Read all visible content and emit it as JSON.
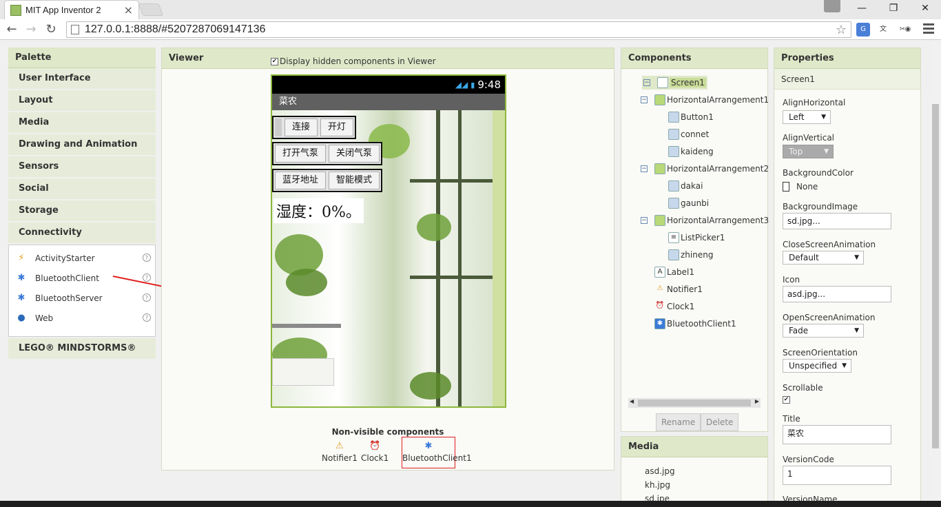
{
  "browser": {
    "tab_title": "MIT App Inventor 2",
    "url": "127.0.0.1:8888/#5207287069147136"
  },
  "palette": {
    "header": "Palette",
    "categories": [
      "User Interface",
      "Layout",
      "Media",
      "Drawing and Animation",
      "Sensors",
      "Social",
      "Storage",
      "Connectivity"
    ],
    "components": [
      {
        "label": "ActivityStarter",
        "icon": "lightning-icon"
      },
      {
        "label": "BluetoothClient",
        "icon": "bluetooth-icon"
      },
      {
        "label": "BluetoothServer",
        "icon": "bluetooth-icon"
      },
      {
        "label": "Web",
        "icon": "globe-icon"
      }
    ],
    "lego": "LEGO® MINDSTORMS®"
  },
  "viewer": {
    "header": "Viewer",
    "hidden_checkbox_label": "Display hidden components in Viewer",
    "phone": {
      "time": "9:48",
      "title": "菜农",
      "row1": [
        "连接",
        "开灯"
      ],
      "row2": [
        "打开气泵",
        "关闭气泵"
      ],
      "row3": [
        "蓝牙地址",
        "智能模式"
      ],
      "humidity": "湿度：0%。"
    },
    "nonvisible_title": "Non-visible components",
    "nonvisible": [
      {
        "label": "Notifier1",
        "icon": "warning-icon"
      },
      {
        "label": "Clock1",
        "icon": "clock-icon"
      },
      {
        "label": "BluetoothClient1",
        "icon": "bluetooth-icon"
      }
    ]
  },
  "components": {
    "header": "Components",
    "tree": [
      {
        "label": "Screen1",
        "level": 0
      },
      {
        "label": "HorizontalArrangement1",
        "level": 1
      },
      {
        "label": "Button1",
        "level": 2
      },
      {
        "label": "connet",
        "level": 2
      },
      {
        "label": "kaideng",
        "level": 2
      },
      {
        "label": "HorizontalArrangement2",
        "level": 1
      },
      {
        "label": "dakai",
        "level": 2
      },
      {
        "label": "gaunbi",
        "level": 2
      },
      {
        "label": "HorizontalArrangement3",
        "level": 1
      },
      {
        "label": "ListPicker1",
        "level": 2
      },
      {
        "label": "zhineng",
        "level": 2
      },
      {
        "label": "Label1",
        "level": 1
      },
      {
        "label": "Notifier1",
        "level": 1
      },
      {
        "label": "Clock1",
        "level": 1
      },
      {
        "label": "BluetoothClient1",
        "level": 1
      }
    ],
    "rename": "Rename",
    "delete": "Delete"
  },
  "media": {
    "header": "Media",
    "files": [
      "asd.jpg",
      "kh.jpg",
      "sd.jpe"
    ]
  },
  "properties": {
    "header": "Properties",
    "component": "Screen1",
    "align_horizontal": {
      "label": "AlignHorizontal",
      "value": "Left"
    },
    "align_vertical": {
      "label": "AlignVertical",
      "value": "Top"
    },
    "background_color": {
      "label": "BackgroundColor",
      "value": "None"
    },
    "background_image": {
      "label": "BackgroundImage",
      "value": "sd.jpg..."
    },
    "close_anim": {
      "label": "CloseScreenAnimation",
      "value": "Default"
    },
    "icon": {
      "label": "Icon",
      "value": "asd.jpg..."
    },
    "open_anim": {
      "label": "OpenScreenAnimation",
      "value": "Fade"
    },
    "orientation": {
      "label": "ScreenOrientation",
      "value": "Unspecified"
    },
    "scrollable": {
      "label": "Scrollable",
      "checked": true
    },
    "title": {
      "label": "Title",
      "value": "菜农"
    },
    "version_code": {
      "label": "VersionCode",
      "value": "1"
    },
    "version_name": {
      "label": "VersionName"
    }
  },
  "colors": {
    "accent_green": "#8cb83c",
    "header_green": "#dfe8c8",
    "annotation_red": "#e02020"
  }
}
